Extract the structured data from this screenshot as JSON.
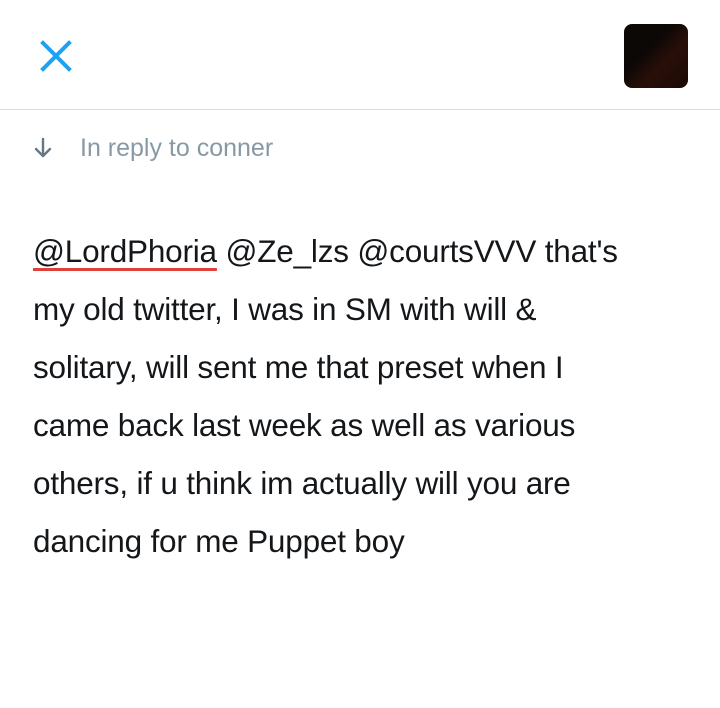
{
  "header": {
    "close_icon": "close-icon",
    "avatar_icon": "avatar"
  },
  "reply": {
    "icon": "down-arrow-icon",
    "text": "In reply to conner"
  },
  "tweet": {
    "mentions": [
      "@LordPhoria",
      "@Ze_lzs",
      "@courtsVVV"
    ],
    "line1_rest": " that's",
    "line2": "my old twitter, I was in SM with will &",
    "line3": "solitary, will sent me that preset when I",
    "line4": "came back last week as well as various",
    "line5": "others, if u think im actually will you are",
    "line6": "dancing for me Puppet boy"
  },
  "colors": {
    "accent": "#1da1f2",
    "muted": "#8899a6",
    "text": "#14171a",
    "divider": "#d8dde2",
    "spellcheck_underline": "#e0403a"
  }
}
